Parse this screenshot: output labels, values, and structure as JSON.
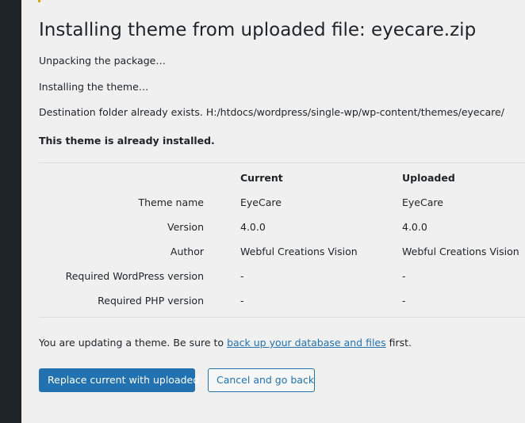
{
  "heading": "Installing theme from uploaded file: eyecare.zip",
  "messages": [
    "Unpacking the package…",
    "Installing the theme…",
    "Destination folder already exists. H:/htdocs/wordpress/single-wp/wp-content/themes/eyecare/"
  ],
  "already_installed": "This theme is already installed.",
  "table": {
    "headers": {
      "current": "Current",
      "uploaded": "Uploaded"
    },
    "rows": [
      {
        "label": "Theme name",
        "current": "EyeCare",
        "uploaded": "EyeCare"
      },
      {
        "label": "Version",
        "current": "4.0.0",
        "uploaded": "4.0.0"
      },
      {
        "label": "Author",
        "current": "Webful Creations Vision",
        "uploaded": "Webful Creations Vision"
      },
      {
        "label": "Required WordPress version",
        "current": "-",
        "uploaded": "-"
      },
      {
        "label": "Required PHP version",
        "current": "-",
        "uploaded": "-"
      }
    ]
  },
  "update_notice": {
    "before": "You are updating a theme. Be sure to ",
    "link": "back up your database and files",
    "after": " first."
  },
  "buttons": {
    "replace": "Replace current with uploaded",
    "cancel": "Cancel and go back"
  },
  "colors": {
    "primary": "#2271b1",
    "sidebar": "#1d2327",
    "background": "#f0f0f1"
  }
}
